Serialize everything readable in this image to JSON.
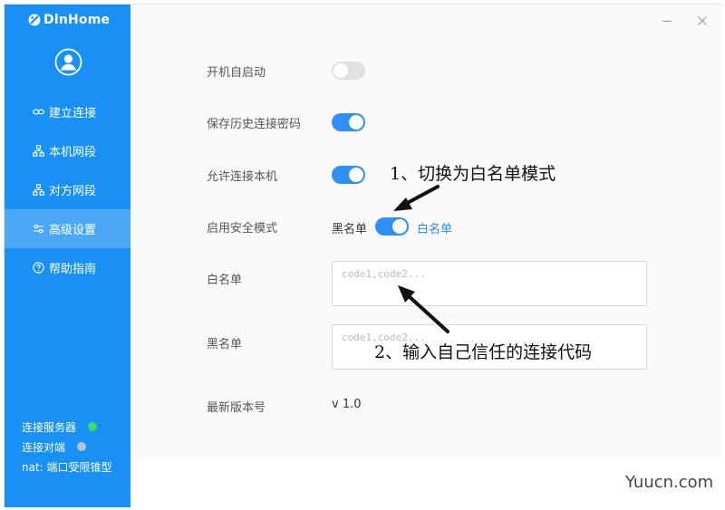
{
  "app": {
    "title": "DlnHome"
  },
  "sidebar": {
    "items": [
      {
        "label": "建立连接",
        "icon": "link-icon"
      },
      {
        "label": "本机网段",
        "icon": "network-icon"
      },
      {
        "label": "对方网段",
        "icon": "network-icon"
      },
      {
        "label": "高级设置",
        "icon": "sliders-icon",
        "active": true
      },
      {
        "label": "帮助指南",
        "icon": "help-circle-icon"
      }
    ],
    "status": {
      "server_label": "连接服务器",
      "server_state": "connected",
      "peer_label": "连接对端",
      "peer_state": "disconnected",
      "nat_label": "nat: 端口受限锥型"
    }
  },
  "settings": {
    "autostart": {
      "label": "开机自启动",
      "on": false
    },
    "save_password": {
      "label": "保存历史连接密码",
      "on": true
    },
    "allow_connect": {
      "label": "允许连接本机",
      "on": true
    },
    "safe_mode": {
      "label": "启用安全模式",
      "left_option": "黑名单",
      "right_option": "白名单",
      "on": true
    },
    "whitelist": {
      "label": "白名单",
      "value": "",
      "placeholder": "code1,code2..."
    },
    "blacklist": {
      "label": "黑名单",
      "value": "",
      "placeholder": "code1,code2..."
    },
    "version": {
      "label": "最新版本号",
      "value": "v 1.0"
    }
  },
  "annotations": {
    "step1": "1、切换为白名单模式",
    "step2": "2、输入自己信任的连接代码"
  },
  "watermark": "Yuucn.com",
  "colors": {
    "sidebar_bg": "#1890f5",
    "switch_on": "#2f8ef7",
    "switch_off": "#e0e0e0",
    "status_connected": "#3edb63",
    "status_disconnected": "#b9c3cd",
    "link_text": "#2f8ef7"
  }
}
